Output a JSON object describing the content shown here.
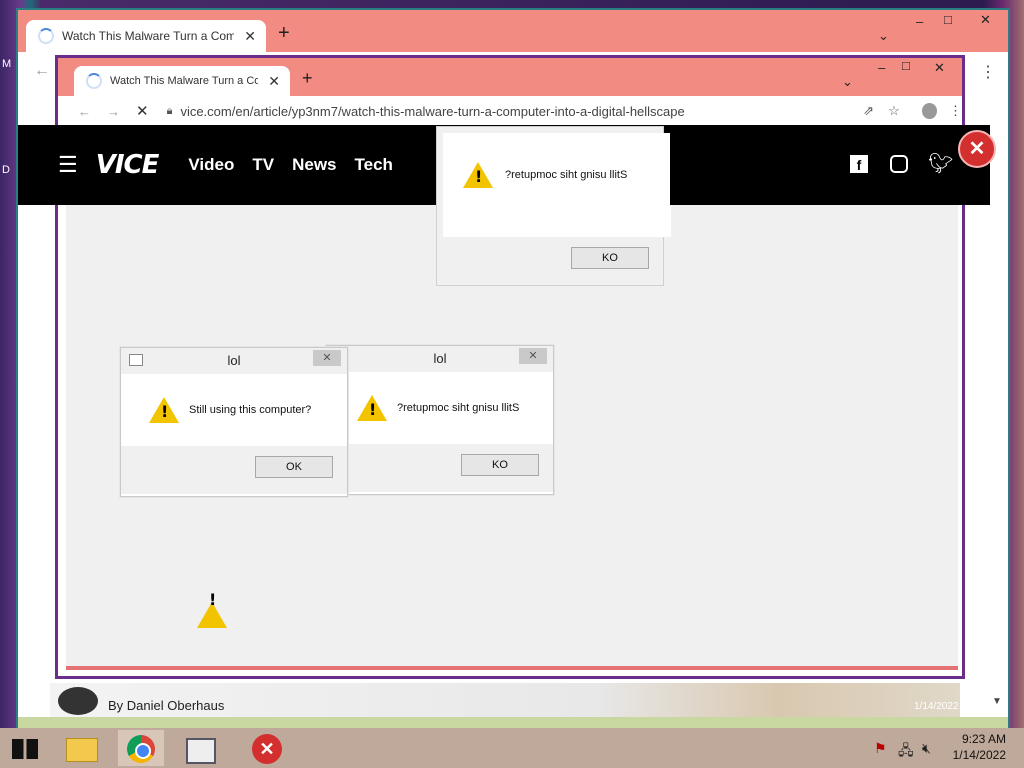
{
  "outer_browser": {
    "tab_title": "Watch This Malware Turn a Computer into a Digital Hellscape",
    "tab_close": "✕",
    "new_tab": "+",
    "controls": {
      "minimize": "–",
      "maximize": "□",
      "close": "✕",
      "dropdown": "⌄"
    },
    "menu": "⋮",
    "left_edge_letter": "M",
    "left_edge_letter2": "D"
  },
  "inner_browser": {
    "tab_title": "Watch This Malware Turn a Computer into a Digital Hellscape",
    "tab_close": "✕",
    "new_tab": "+",
    "controls": {
      "minimize": "–",
      "maximize": "□",
      "close": "✕",
      "dropdown": "⌄"
    },
    "url": "vice.com/en/article/yp3nm7/watch-this-malware-turn-a-computer-into-a-digital-hellscape"
  },
  "vice": {
    "logo": "VICE",
    "nav": [
      "Video",
      "TV",
      "News",
      "Tech"
    ],
    "social": [
      "facebook-icon",
      "instagram-icon",
      "twitter-icon"
    ]
  },
  "dialogs": {
    "top": {
      "message": "?retupmoc siht gnisu llitS",
      "button": "KO"
    },
    "left": {
      "title": "lol",
      "message": "Still using this computer?",
      "button": "OK"
    },
    "middle": {
      "title": "lol",
      "message": "?retupmoc siht gnisu llitS",
      "button": "KO"
    }
  },
  "footer_strip": {
    "byline": "By Daniel Oberhaus"
  },
  "taskbar": {
    "time": "9:23 AM",
    "date": "1/14/2022",
    "ghost_date": "1/14/2022"
  },
  "colors": {
    "tabstrip": "#f28b82",
    "accent_teal": "#2a7f85",
    "warning_yellow": "#f2c400",
    "error_red": "#d32f2f"
  }
}
